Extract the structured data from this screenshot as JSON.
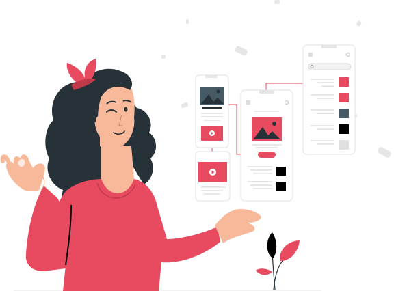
{
  "illustration": {
    "colors": {
      "accent": "#e84a5f",
      "accent_dark": "#c0394b",
      "hair": "#263238",
      "skin": "#f8b99b",
      "phone_border": "#e6e6e6",
      "slate": "#455a64",
      "line_gray": "#c7c7c7",
      "black": "#000000",
      "light_gray": "#e0e0e0"
    },
    "icons": [
      "image-placeholder-icon",
      "play-icon",
      "search-icon",
      "menu-icon",
      "bell-icon"
    ],
    "color_swatches": [
      "#e84a5f",
      "#e84a5f",
      "#455a64",
      "#000000",
      "#e0e0e0"
    ]
  }
}
